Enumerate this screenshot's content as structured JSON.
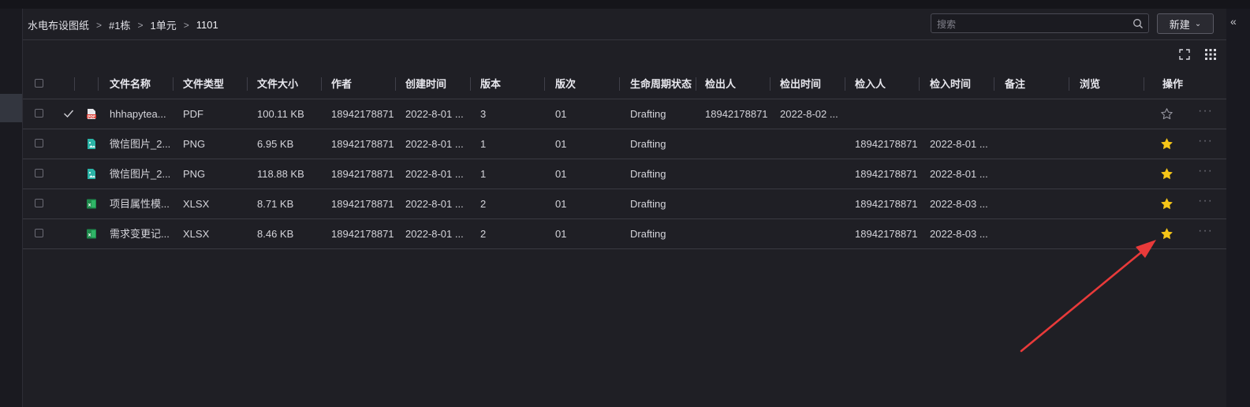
{
  "breadcrumb": [
    "水电布设图纸",
    "#1栋",
    "1单元",
    "1101"
  ],
  "search": {
    "placeholder": "搜索"
  },
  "new_button": {
    "label": "新建"
  },
  "columns": [
    "文件名称",
    "文件类型",
    "文件大小",
    "作者",
    "创建时间",
    "版本",
    "版次",
    "生命周期状态",
    "检出人",
    "检出时间",
    "检入人",
    "检入时间",
    "备注",
    "浏览",
    "操作"
  ],
  "rows": [
    {
      "icon": "pdf-file-icon",
      "name": "hhhapytea...",
      "type": "PDF",
      "size": "100.11 KB",
      "author": "18942178871",
      "created": "2022-8-01 ...",
      "version": "3",
      "revision": "01",
      "lifecycle": "Drafting",
      "checkout_by": "18942178871",
      "checkout_time": "2022-8-02 ...",
      "checkin_by": "",
      "checkin_time": "",
      "remark": "",
      "browse": "",
      "checked_out_mark": true,
      "favorite": false
    },
    {
      "icon": "image-file-icon",
      "name": "微信图片_2...",
      "type": "PNG",
      "size": "6.95 KB",
      "author": "18942178871",
      "created": "2022-8-01 ...",
      "version": "1",
      "revision": "01",
      "lifecycle": "Drafting",
      "checkout_by": "",
      "checkout_time": "",
      "checkin_by": "18942178871",
      "checkin_time": "2022-8-01 ...",
      "remark": "",
      "browse": "",
      "checked_out_mark": false,
      "favorite": true
    },
    {
      "icon": "image-file-icon",
      "name": "微信图片_2...",
      "type": "PNG",
      "size": "118.88 KB",
      "author": "18942178871",
      "created": "2022-8-01 ...",
      "version": "1",
      "revision": "01",
      "lifecycle": "Drafting",
      "checkout_by": "",
      "checkout_time": "",
      "checkin_by": "18942178871",
      "checkin_time": "2022-8-01 ...",
      "remark": "",
      "browse": "",
      "checked_out_mark": false,
      "favorite": true
    },
    {
      "icon": "excel-file-icon",
      "name": "项目属性模...",
      "type": "XLSX",
      "size": "8.71 KB",
      "author": "18942178871",
      "created": "2022-8-01 ...",
      "version": "2",
      "revision": "01",
      "lifecycle": "Drafting",
      "checkout_by": "",
      "checkout_time": "",
      "checkin_by": "18942178871",
      "checkin_time": "2022-8-03 ...",
      "remark": "",
      "browse": "",
      "checked_out_mark": false,
      "favorite": true
    },
    {
      "icon": "excel-file-icon",
      "name": "需求变更记...",
      "type": "XLSX",
      "size": "8.46 KB",
      "author": "18942178871",
      "created": "2022-8-01 ...",
      "version": "2",
      "revision": "01",
      "lifecycle": "Drafting",
      "checkout_by": "",
      "checkout_time": "",
      "checkin_by": "18942178871",
      "checkin_time": "2022-8-03 ...",
      "remark": "",
      "browse": "",
      "checked_out_mark": false,
      "favorite": true
    }
  ],
  "colors": {
    "accent_star": "#f5c518",
    "annotation_arrow": "#e83a3a",
    "background": "#1f1f25"
  }
}
